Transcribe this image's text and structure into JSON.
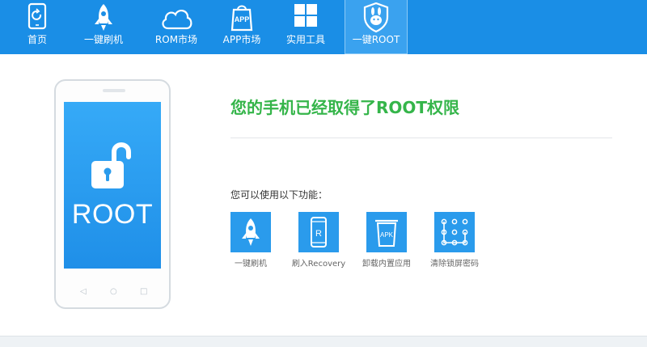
{
  "nav": {
    "items": [
      {
        "label": "首页",
        "icon": "home-icon"
      },
      {
        "label": "一键刷机",
        "icon": "rocket-icon"
      },
      {
        "label": "ROM市场",
        "icon": "cloud-icon"
      },
      {
        "label": "APP市场",
        "icon": "app-bag-icon",
        "badge": "APP"
      },
      {
        "label": "实用工具",
        "icon": "grid-icon"
      },
      {
        "label": "一键ROOT",
        "icon": "shield-rabbit-icon",
        "active": true
      }
    ]
  },
  "phone": {
    "screen_label": "ROOT",
    "buttons": [
      "◁",
      "○",
      "□"
    ]
  },
  "main": {
    "title": "您的手机已经取得了ROOT权限",
    "subtitle": "您可以使用以下功能："
  },
  "features": [
    {
      "label": "一键刷机",
      "icon": "rocket-icon"
    },
    {
      "label": "刷入Recovery",
      "icon": "phone-r-icon",
      "glyph": "R"
    },
    {
      "label": "卸载内置应用",
      "icon": "apk-bin-icon",
      "glyph": "APK"
    },
    {
      "label": "清除锁屏密码",
      "icon": "pattern-lock-icon"
    }
  ],
  "colors": {
    "toolbar": "#1a8ee6",
    "active_tab": "#3aa2ef",
    "title_green": "#35b54a",
    "tile_blue": "#2a9bec"
  }
}
